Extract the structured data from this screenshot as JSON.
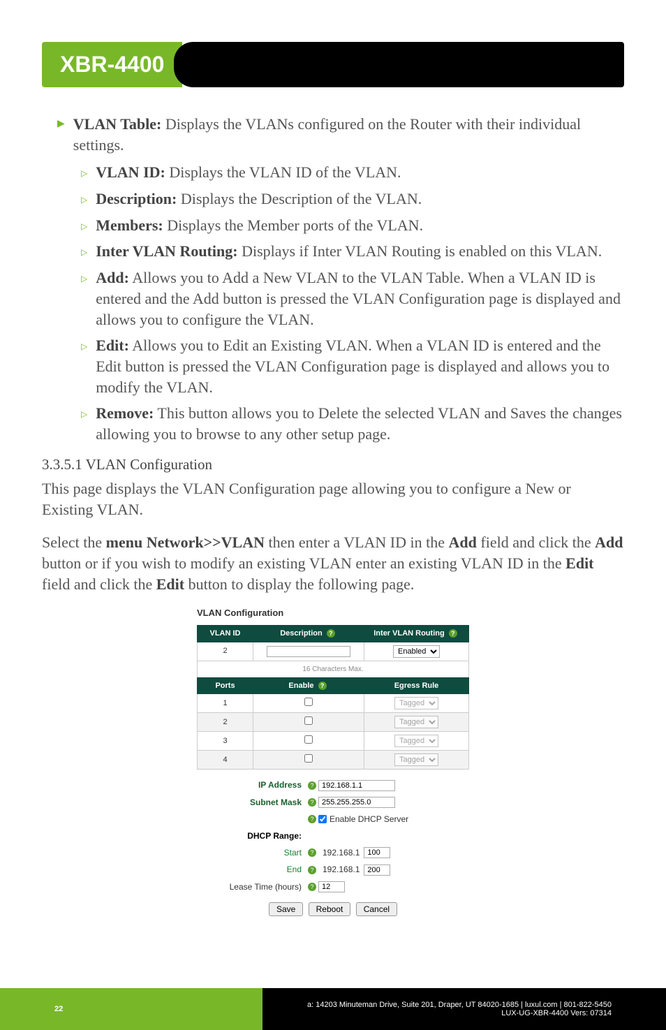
{
  "header": {
    "product": "XBR-4400"
  },
  "bullets": {
    "vlan_table_label": "VLAN Table:",
    "vlan_table_text": " Displays the VLANs configured on the Router with their individual settings.",
    "vlan_id_label": "VLAN ID:",
    "vlan_id_text": " Displays the VLAN ID of the VLAN.",
    "description_label": "Description:",
    "description_text": " Displays the Description of the VLAN.",
    "members_label": "Members:",
    "members_text": " Displays the Member ports of the VLAN.",
    "ivr_label": "Inter VLAN Routing:",
    "ivr_text": " Displays if Inter VLAN Routing is enabled on this VLAN.",
    "add_label": "Add:",
    "add_text": " Allows you to Add a New VLAN to the VLAN Table. When a VLAN ID is entered and the Add button is pressed the VLAN Configuration page is displayed and allows you to configure the VLAN.",
    "edit_label": "Edit:",
    "edit_text": " Allows you to Edit an Existing VLAN. When a VLAN ID is entered and the Edit button is pressed the VLAN Configuration page is displayed and allows you to modify the VLAN.",
    "remove_label": "Remove:",
    "remove_text": " This button allows you to Delete the selected VLAN and Saves the changes allowing you to browse to any other setup page."
  },
  "section": {
    "heading": "3.3.5.1 VLAN Configuration",
    "p1": "This page displays the VLAN Configuration page allowing you to configure a New or Existing VLAN.",
    "p2_a": "Select the ",
    "p2_b": "menu Network>>VLAN",
    "p2_c": " then enter a VLAN ID in the ",
    "p2_d": "Add",
    "p2_e": " field and click the ",
    "p2_f": "Add",
    "p2_g": " button or if you wish to modify an existing VLAN enter an existing VLAN ID in the ",
    "p2_h": "Edit",
    "p2_i": " field and click the ",
    "p2_j": "Edit",
    "p2_k": " button to display the following page."
  },
  "shot": {
    "title": "VLAN Configuration",
    "hdr_vlanid": "VLAN ID",
    "hdr_desc": "Description",
    "hdr_ivr": "Inter VLAN Routing",
    "vlan_id_val": "2",
    "desc_hint": "16 Characters Max.",
    "ivr_val": "Enabled",
    "hdr_ports": "Ports",
    "hdr_enable": "Enable",
    "hdr_egress": "Egress Rule",
    "ports": [
      {
        "n": "1",
        "egress": "Tagged"
      },
      {
        "n": "2",
        "egress": "Tagged"
      },
      {
        "n": "3",
        "egress": "Tagged"
      },
      {
        "n": "4",
        "egress": "Tagged"
      }
    ],
    "ip_label": "IP Address",
    "ip_val": "192.168.1.1",
    "mask_label": "Subnet Mask",
    "mask_val": "255.255.255.0",
    "enable_dhcp": "Enable DHCP Server",
    "dhcp_range": "DHCP Range:",
    "start_label": "Start",
    "start_prefix": "192.168.1",
    "start_val": "100",
    "end_label": "End",
    "end_prefix": "192.168.1",
    "end_val": "200",
    "lease_label": "Lease Time (hours)",
    "lease_val": "12",
    "btn_save": "Save",
    "btn_reboot": "Reboot",
    "btn_cancel": "Cancel"
  },
  "footer": {
    "page": "22",
    "addr": "a: 14203 Minuteman Drive, Suite 201, Draper, UT 84020-1685 | luxul.com | 801-822-5450",
    "doc": "LUX-UG-XBR-4400  Vers: 07314"
  }
}
